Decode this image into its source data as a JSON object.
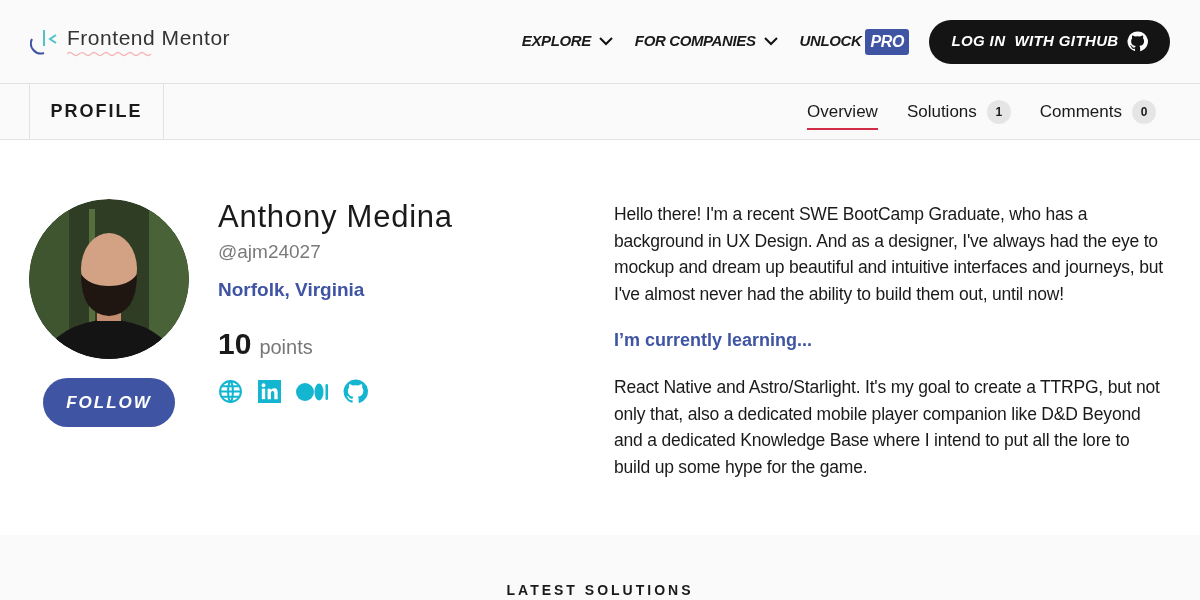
{
  "header": {
    "logo_text": "Frontend Mentor",
    "nav": [
      {
        "label": "EXPLORE",
        "kind": "dropdown"
      },
      {
        "label": "FOR COMPANIES",
        "kind": "dropdown"
      },
      {
        "label": "UNLOCK",
        "kind": "pro",
        "badge": "PRO"
      }
    ],
    "login": {
      "parts": [
        "LOG IN",
        "WITH GITHUB"
      ]
    }
  },
  "subnav": {
    "title": "PROFILE",
    "tabs": [
      {
        "label": "Overview",
        "selected": true
      },
      {
        "label": "Solutions",
        "count": "1",
        "selected": false
      },
      {
        "label": "Comments",
        "count": "0",
        "selected": false
      }
    ]
  },
  "profile": {
    "follow": "FOLLOW",
    "name": "Anthony Medina",
    "handle": "@ajm24027",
    "location": "Norfolk, Virginia",
    "points": "10",
    "points_label": "points",
    "links": [
      {
        "kind": "website"
      },
      {
        "kind": "linkedin"
      },
      {
        "kind": "medium"
      },
      {
        "kind": "github"
      }
    ]
  },
  "bio": [
    {
      "kind": "paragraph",
      "text": "Hello there! I'm a recent SWE BootCamp Graduate, who has a background in UX Design. And as a designer, I've always had the eye to mockup and dream up beautiful and intuitive interfaces and journeys, but I've almost never had the ability to build them out, until now!"
    },
    {
      "kind": "heading",
      "text": "I’m currently learning..."
    },
    {
      "kind": "paragraph",
      "text": "React Native and Astro/Starlight. It's my goal to create a TTRPG, but not only that, also a dedicated mobile player companion like D&D Beyond and a dedicated Knowledge Base where I intend to put all the lore to build up some hype for the game."
    }
  ],
  "latest": {
    "title": "LATEST SOLUTIONS"
  }
}
